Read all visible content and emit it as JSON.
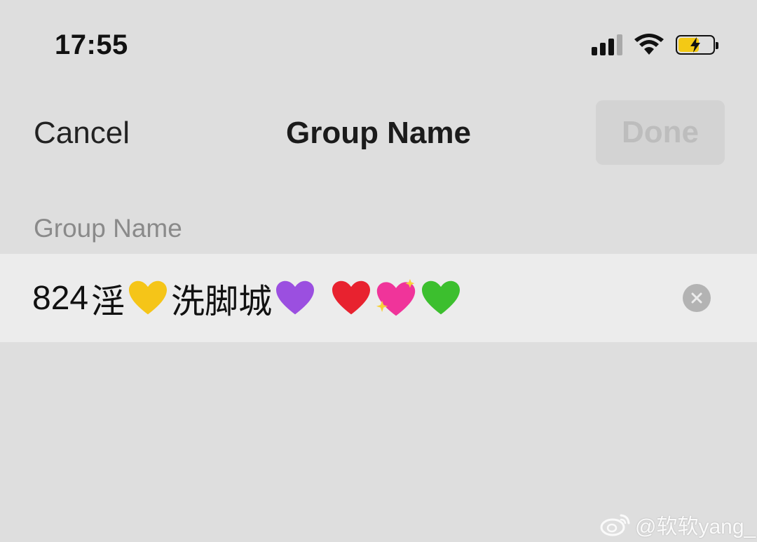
{
  "status_bar": {
    "time": "17:55",
    "icons": [
      "cellular-signal-icon",
      "wifi-icon",
      "battery-charging-icon"
    ]
  },
  "nav": {
    "cancel_label": "Cancel",
    "title": "Group Name",
    "done_label": "Done"
  },
  "section": {
    "header": "Group Name"
  },
  "input": {
    "value_parts": {
      "number": "824",
      "char1": "淫",
      "heart1": "yellow-heart-icon",
      "chars2": "洗脚城",
      "heart2": "purple-heart-icon",
      "heart3": "red-heart-icon",
      "heart4": "sparkling-heart-icon",
      "heart5": "green-heart-icon"
    },
    "clear_icon": "clear-icon"
  },
  "watermark": {
    "text": "@软软yang_",
    "icon": "weibo-logo-icon"
  },
  "colors": {
    "background": "#dedede",
    "cell": "#ececec",
    "done_bg": "#d3d3d3",
    "done_text": "#bdbdbd",
    "header_text": "#8a8a8a",
    "battery_fill": "#f3c915",
    "heart_yellow": "#f5c518",
    "heart_purple": "#9b4fe0",
    "heart_red": "#e8222f",
    "heart_pink": "#f0349a",
    "heart_green": "#3cbf2e"
  }
}
